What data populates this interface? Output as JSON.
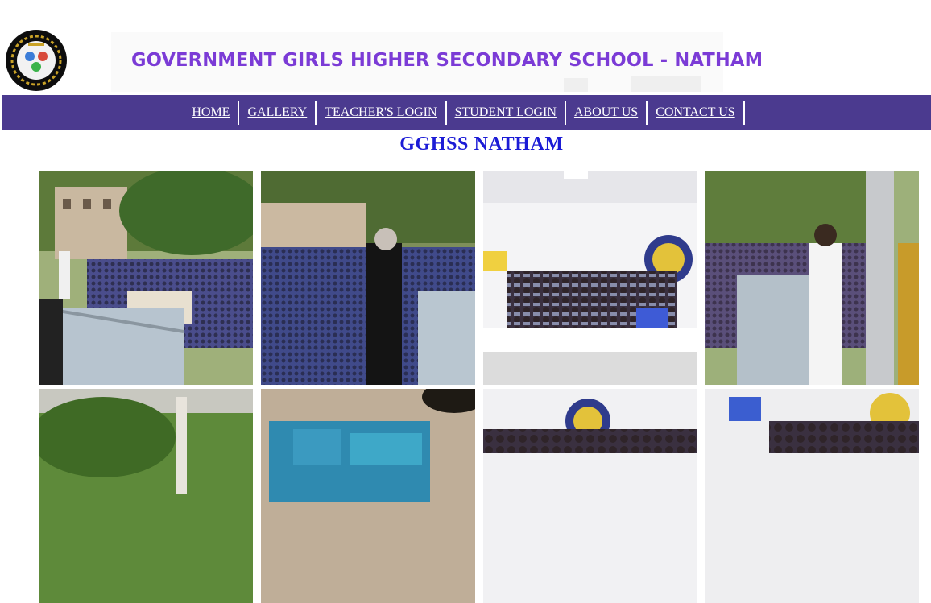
{
  "header": {
    "logo_icon": "school-emblem-icon",
    "title": "GOVERNMENT GIRLS HIGHER SECONDARY SCHOOL - NATHAM"
  },
  "nav": {
    "items": [
      "HOME",
      "GALLERY",
      "TEACHER'S LOGIN",
      "STUDENT LOGIN",
      "ABOUT US",
      "CONTACT US"
    ],
    "background": "#4b3a8f"
  },
  "main": {
    "heading": "GGHSS NATHAM",
    "heading_color": "#1c1cd6",
    "gallery_photos": [
      "assembly-photo-1",
      "assembly-photo-2",
      "classroom-group-photo",
      "assembly-speaker-photo",
      "campus-garden-photo",
      "wall-mural-photo",
      "classroom-students-photo-2",
      "classroom-students-photo-3"
    ]
  },
  "colors": {
    "title_purple": "#7b3bd6",
    "nav_purple": "#4b3a8f",
    "heading_blue": "#1c1cd6"
  }
}
